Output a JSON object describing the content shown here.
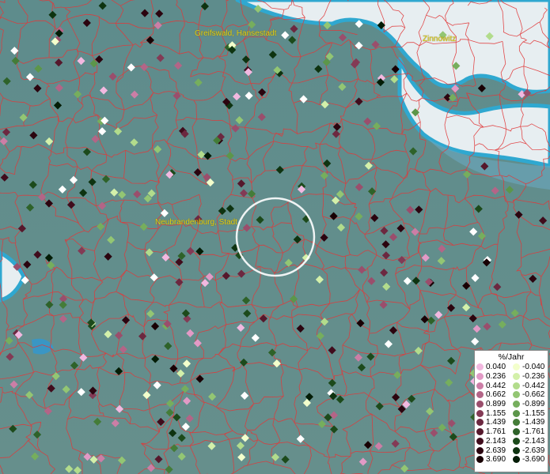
{
  "map": {
    "places": [
      {
        "name": "Greifswald, Hansestadt"
      },
      {
        "name": "Zinnowitz"
      },
      {
        "name": "Neubrandenburg, Stadt"
      }
    ]
  },
  "legend": {
    "title": "%/Jahr",
    "positive": [
      {
        "value": "0.040",
        "color": "#f2b8e0"
      },
      {
        "value": "0.236",
        "color": "#e29ac6"
      },
      {
        "value": "0.442",
        "color": "#cc7ea6"
      },
      {
        "value": "0.662",
        "color": "#b36587"
      },
      {
        "value": "0.899",
        "color": "#9a4e6c"
      },
      {
        "value": "1.155",
        "color": "#833a55"
      },
      {
        "value": "1.439",
        "color": "#6c2840"
      },
      {
        "value": "1.761",
        "color": "#55182c"
      },
      {
        "value": "2.143",
        "color": "#400c1c"
      },
      {
        "value": "2.639",
        "color": "#2b040f"
      },
      {
        "value": "3.690",
        "color": "#180004"
      }
    ],
    "negative": [
      {
        "value": "-0.040",
        "color": "#f3ffcc"
      },
      {
        "value": "-0.236",
        "color": "#d3f0aa"
      },
      {
        "value": "-0.442",
        "color": "#b2dc8c"
      },
      {
        "value": "-0.662",
        "color": "#93c673"
      },
      {
        "value": "-0.899",
        "color": "#76ae5d"
      },
      {
        "value": "-1.155",
        "color": "#5c964a"
      },
      {
        "value": "-1.439",
        "color": "#447c38"
      },
      {
        "value": "-1.761",
        "color": "#2e6229"
      },
      {
        "value": "-2.143",
        "color": "#1c4a1b"
      },
      {
        "value": "-2.639",
        "color": "#0e3310"
      },
      {
        "value": "-3.690",
        "color": "#031c06"
      }
    ]
  },
  "colors": {
    "land": "#5f8e8e",
    "sea": "#e4eef2",
    "coast": "#2fa8d0",
    "boundary": "#e0383a",
    "label": "#e0d21e",
    "highlight": "#ffffff"
  }
}
